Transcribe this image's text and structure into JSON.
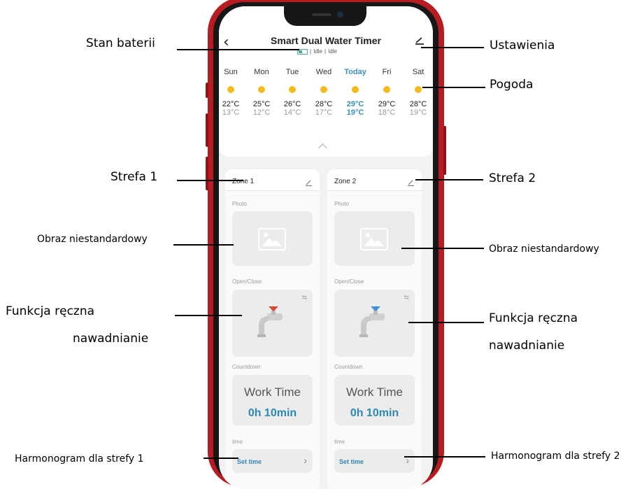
{
  "app": {
    "back_icon": "chevron-left-icon",
    "title": "Smart Dual Water Timer",
    "status": {
      "battery_icon": "battery-icon",
      "separator": "|",
      "zone1_state": "Idle",
      "zone2_state": "Idle"
    },
    "settings_icon": "pencil-icon"
  },
  "weather": {
    "days": [
      {
        "name": "Sun",
        "high": "22°C",
        "low": "13°C",
        "icon": "sun-icon"
      },
      {
        "name": "Mon",
        "high": "25°C",
        "low": "12°C",
        "icon": "sun-icon"
      },
      {
        "name": "Tue",
        "high": "26°C",
        "low": "14°C",
        "icon": "sun-icon"
      },
      {
        "name": "Wed",
        "high": "28°C",
        "low": "17°C",
        "icon": "sun-icon"
      },
      {
        "name": "Today",
        "high": "29°C",
        "low": "19°C",
        "icon": "sun-icon"
      },
      {
        "name": "Fri",
        "high": "29°C",
        "low": "18°C",
        "icon": "sun-icon"
      },
      {
        "name": "Sat",
        "high": "28°C",
        "low": "19°C",
        "icon": "sun-icon"
      }
    ],
    "collapse_icon": "chevron-up-icon"
  },
  "zones": [
    {
      "name": "Zone 1",
      "photo_label": "Photo",
      "open_close_label": "Open/Close",
      "valve_color": "#d64533",
      "countdown_label": "Countdown",
      "work_time_label": "Work Time",
      "work_time_value": "0h 10min",
      "time_label": "time",
      "set_time_label": "Set time"
    },
    {
      "name": "Zone 2",
      "photo_label": "Photo",
      "open_close_label": "Open/Close",
      "valve_color": "#3f8fd6",
      "countdown_label": "Countdown",
      "work_time_label": "Work Time",
      "work_time_value": "0h 10min",
      "time_label": "time",
      "set_time_label": "Set time"
    }
  ],
  "annotations": {
    "battery": "Stan baterii",
    "settings": "Ustawienia",
    "weather": "Pogoda",
    "zone1": "Strefa 1",
    "zone2": "Strefa 2",
    "custom_image_left": "Obraz niestandardowy",
    "custom_image_right": "Obraz niestandardowy",
    "manual_left_line1": "Funkcja ręczna",
    "manual_left_line2": "nawadnianie",
    "manual_right_line1": "Funkcja ręczna",
    "manual_right_line2": "nawadnianie",
    "schedule_left": "Harmonogram dla strefy 1",
    "schedule_right": "Harmonogram dla strefy 2"
  },
  "colors": {
    "phone_frame": "#b71c22",
    "accent_blue": "#2e88b5",
    "sun": "#f5b91d"
  }
}
